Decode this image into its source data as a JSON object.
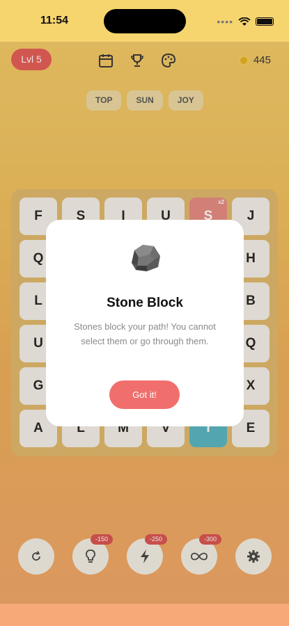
{
  "status": {
    "time": "11:54",
    "dots": "••••"
  },
  "header": {
    "level": "Lvl 5",
    "coins": "445"
  },
  "words": [
    "TOP",
    "SUN",
    "JOY"
  ],
  "grid": [
    [
      "F",
      "S",
      "I",
      "U",
      "S",
      "J"
    ],
    [
      "Q",
      "",
      "",
      "",
      "",
      "H"
    ],
    [
      "L",
      "",
      "",
      "",
      "",
      "B"
    ],
    [
      "U",
      "",
      "",
      "",
      "",
      "Q"
    ],
    [
      "G",
      "",
      "",
      "",
      "",
      "X"
    ],
    [
      "A",
      "L",
      "M",
      "V",
      "I",
      "E"
    ]
  ],
  "special_tile_mult": "x2",
  "powerups": {
    "hint_cost": "-150",
    "bolt_cost": "-250",
    "infinity_cost": "-300"
  },
  "modal": {
    "title": "Stone Block",
    "body": "Stones block your path! You cannot select them or go through them.",
    "button": "Got it!"
  },
  "colors": {
    "accent": "#f06f6c",
    "level_badge": "#e45a55"
  }
}
